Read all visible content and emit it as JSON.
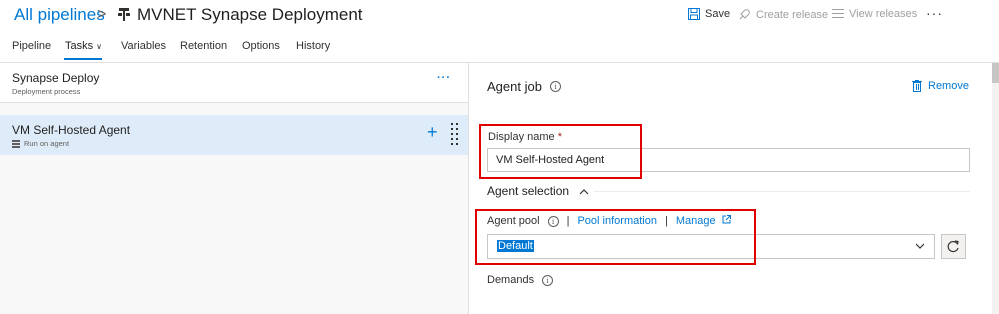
{
  "header": {
    "breadcrumb_link": "All pipelines",
    "breadcrumb_separator": ">",
    "pipeline_icon": "release-pipeline-icon",
    "title": "MVNET Synapse Deployment",
    "save_label": "Save",
    "create_release_label": "Create release",
    "view_releases_label": "View releases",
    "more_label": "···"
  },
  "tabs": [
    {
      "label": "Pipeline"
    },
    {
      "label": "Tasks",
      "active": true,
      "has_dropdown": true
    },
    {
      "label": "Variables"
    },
    {
      "label": "Retention"
    },
    {
      "label": "Options"
    },
    {
      "label": "History"
    }
  ],
  "left_panel": {
    "stage": {
      "title": "Synapse Deploy",
      "subtitle": "Deployment process",
      "more_label": "···"
    },
    "job": {
      "title": "VM Self-Hosted Agent",
      "subtitle": "Run on agent",
      "add_label": "+"
    }
  },
  "right_panel": {
    "heading": "Agent job",
    "info_glyph": "i",
    "remove_label": "Remove",
    "display_name_label": "Display name",
    "required_marker": "*",
    "display_name_value": "VM Self-Hosted Agent",
    "agent_selection_label": "Agent selection",
    "agent_pool_label": "Agent pool",
    "pool_information_link": "Pool information",
    "manage_link": "Manage",
    "separator": "|",
    "agent_pool_value": "Default",
    "demands_label": "Demands"
  },
  "colors": {
    "accent": "#0078d4",
    "selected_row": "#deecf9",
    "highlight_border": "#e00000"
  }
}
